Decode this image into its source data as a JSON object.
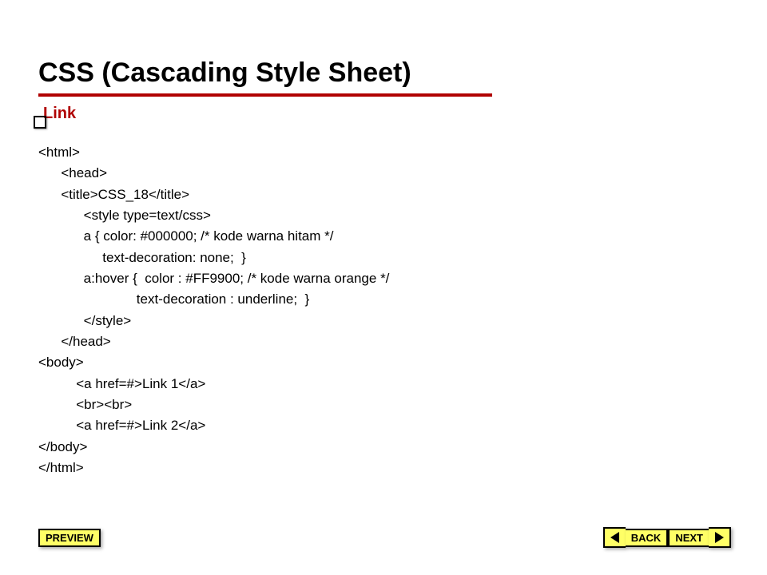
{
  "title": "CSS (Cascading Style Sheet)",
  "subhead": "Link",
  "code": "<html>\n      <head>\n      <title>CSS_18</title>\n            <style type=text/css>\n            a { color: #000000; /* kode warna hitam */\n                 text-decoration: none;  }\n            a:hover {  color : #FF9900; /* kode warna orange */\n                          text-decoration : underline;  }\n            </style>\n      </head>\n<body>\n          <a href=#>Link 1</a>\n          <br><br>\n          <a href=#>Link 2</a>\n</body>\n</html>",
  "nav": {
    "preview": "PREVIEW",
    "back": "BACK",
    "next": "NEXT"
  }
}
